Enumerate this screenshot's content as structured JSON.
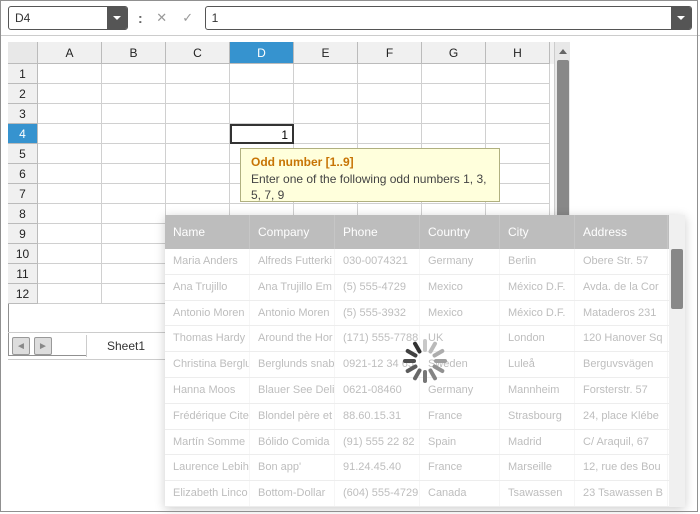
{
  "toolbar": {
    "cell_ref": "D4",
    "formula_value": "1"
  },
  "columns": [
    "A",
    "B",
    "C",
    "D",
    "E",
    "F",
    "G",
    "H"
  ],
  "rows": [
    "1",
    "2",
    "3",
    "4",
    "5",
    "6",
    "7",
    "8",
    "9",
    "10",
    "11",
    "12"
  ],
  "active_col_index": 3,
  "active_row_index": 3,
  "active_cell_value": "1",
  "sheet_tab": "Sheet1",
  "tooltip": {
    "title": "Odd number [1..9]",
    "body": "Enter one of the following odd numbers 1, 3, 5, 7, 9"
  },
  "table": {
    "headers": [
      "Name",
      "Company",
      "Phone",
      "Country",
      "City",
      "Address"
    ],
    "rows": [
      [
        "Maria Anders",
        "Alfreds Futterki",
        "030-0074321",
        "Germany",
        "Berlin",
        "Obere Str. 57"
      ],
      [
        "Ana Trujillo",
        "Ana Trujillo Em",
        "(5) 555-4729",
        "Mexico",
        "México D.F.",
        "Avda. de la Cor"
      ],
      [
        "Antonio Moren",
        "Antonio Moren",
        "(5) 555-3932",
        "Mexico",
        "México D.F.",
        "Mataderos  231"
      ],
      [
        "Thomas Hardy",
        "Around the Hor",
        "(171) 555-7788",
        "UK",
        "London",
        "120 Hanover Sq"
      ],
      [
        "Christina Berglu",
        "Berglunds snab",
        "0921-12 34 65",
        "Sweden",
        "Luleå",
        "Berguvsvägen"
      ],
      [
        "Hanna Moos",
        "Blauer See Deli",
        "0621-08460",
        "Germany",
        "Mannheim",
        "Forsterstr. 57"
      ],
      [
        "Frédérique Cite",
        "Blondel père et",
        "88.60.15.31",
        "France",
        "Strasbourg",
        "24, place Klébe"
      ],
      [
        "Martín Somme",
        "Bólido Comida",
        "(91) 555 22 82",
        "Spain",
        "Madrid",
        "C/ Araquil, 67"
      ],
      [
        "Laurence Lebih",
        "Bon app'",
        "91.24.45.40",
        "France",
        "Marseille",
        "12, rue des Bou"
      ],
      [
        "Elizabeth Linco",
        "Bottom-Dollar",
        "(604) 555-4729",
        "Canada",
        "Tsawassen",
        "23 Tsawassen B"
      ]
    ]
  }
}
